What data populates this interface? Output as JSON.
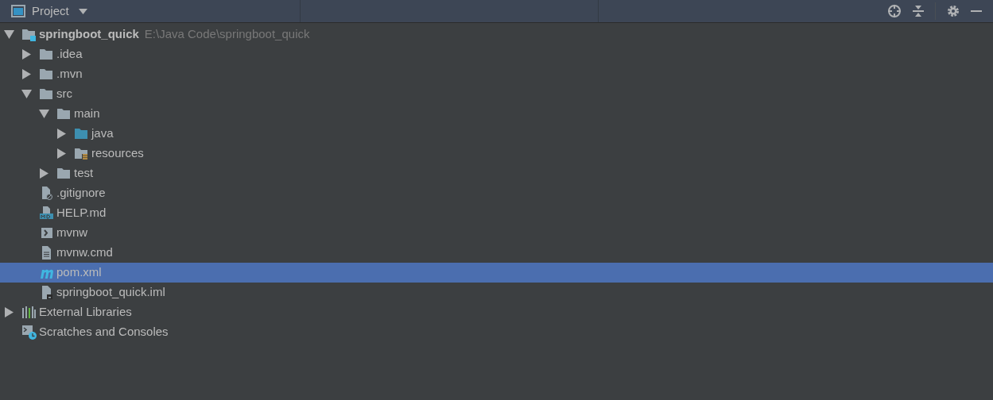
{
  "panel": {
    "title": "Project"
  },
  "tree": [
    {
      "label": "springboot_quick",
      "hint": "E:\\Java Code\\springboot_quick",
      "kind": "module",
      "expanded": true,
      "selected": false,
      "children": [
        {
          "label": ".idea",
          "kind": "folder",
          "expanded": false,
          "selected": false
        },
        {
          "label": ".mvn",
          "kind": "folder",
          "expanded": false,
          "selected": false
        },
        {
          "label": "src",
          "kind": "folder",
          "expanded": true,
          "selected": false,
          "children": [
            {
              "label": "main",
              "kind": "folder",
              "expanded": true,
              "selected": false,
              "children": [
                {
                  "label": "java",
                  "kind": "source-folder",
                  "expanded": false,
                  "selected": false
                },
                {
                  "label": "resources",
                  "kind": "resource-folder",
                  "expanded": false,
                  "selected": false
                }
              ]
            },
            {
              "label": "test",
              "kind": "folder",
              "expanded": false,
              "selected": false
            }
          ]
        },
        {
          "label": ".gitignore",
          "kind": "ignore-file",
          "selected": false
        },
        {
          "label": "HELP.md",
          "kind": "markdown-file",
          "selected": false
        },
        {
          "label": "mvnw",
          "kind": "script-file",
          "selected": false
        },
        {
          "label": "mvnw.cmd",
          "kind": "text-file",
          "selected": false
        },
        {
          "label": "pom.xml",
          "kind": "maven-file",
          "selected": true
        },
        {
          "label": "springboot_quick.iml",
          "kind": "iml-file",
          "selected": false
        }
      ]
    },
    {
      "label": "External Libraries",
      "kind": "libraries",
      "expanded": false,
      "selected": false
    },
    {
      "label": "Scratches and Consoles",
      "kind": "scratches",
      "selected": false
    }
  ]
}
